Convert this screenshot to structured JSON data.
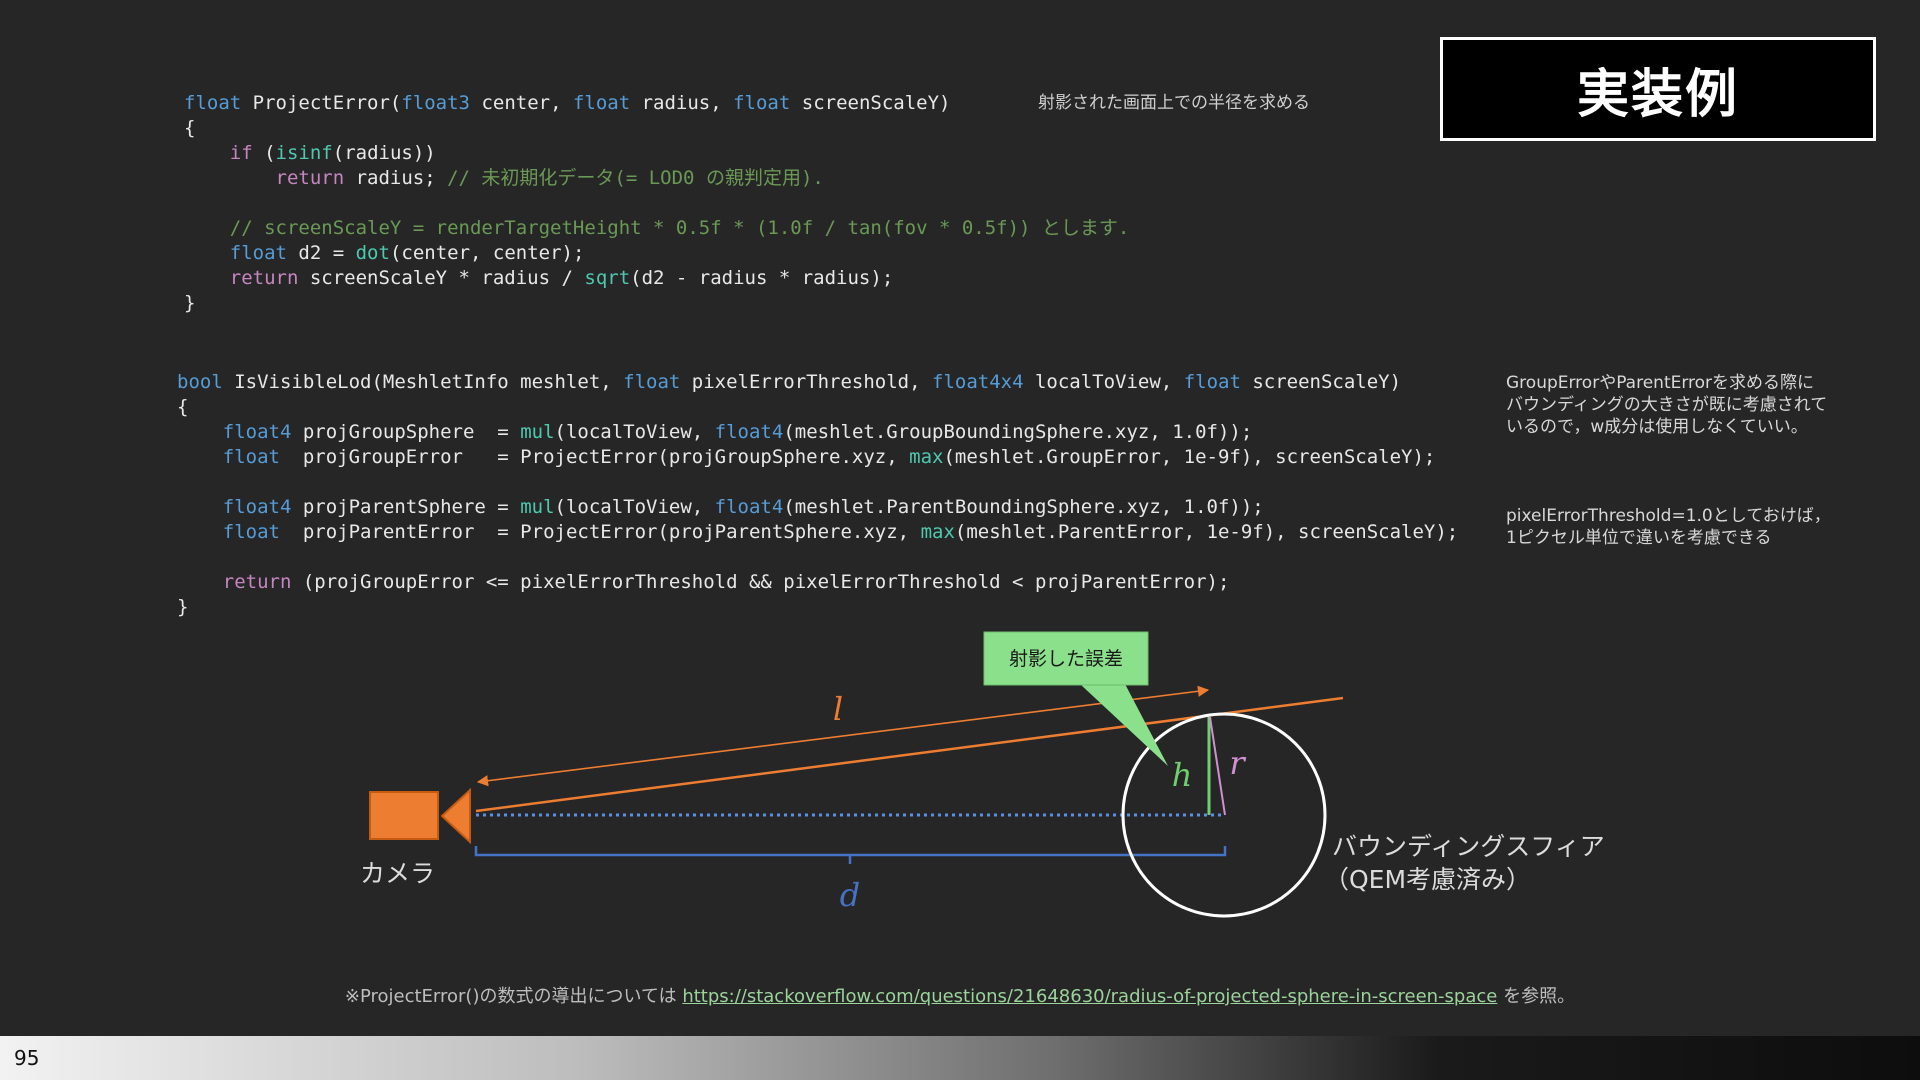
{
  "title": "実装例",
  "page_number": "95",
  "code1": {
    "lines": [
      [
        {
          "c": "kw",
          "t": "float"
        },
        {
          "c": "",
          "t": " ProjectError("
        },
        {
          "c": "kw",
          "t": "float3"
        },
        {
          "c": "",
          "t": " center, "
        },
        {
          "c": "kw",
          "t": "float"
        },
        {
          "c": "",
          "t": " radius, "
        },
        {
          "c": "kw",
          "t": "float"
        },
        {
          "c": "",
          "t": " screenScaleY)"
        }
      ],
      [
        {
          "c": "",
          "t": "{"
        }
      ],
      [
        {
          "c": "",
          "t": "    "
        },
        {
          "c": "ctl",
          "t": "if"
        },
        {
          "c": "",
          "t": " ("
        },
        {
          "c": "fn",
          "t": "isinf"
        },
        {
          "c": "",
          "t": "(radius))"
        }
      ],
      [
        {
          "c": "",
          "t": "        "
        },
        {
          "c": "ctl",
          "t": "return"
        },
        {
          "c": "",
          "t": " radius; "
        },
        {
          "c": "cm",
          "t": "// 未初期化データ(= LOD0 の親判定用)."
        }
      ],
      [
        {
          "c": "",
          "t": ""
        }
      ],
      [
        {
          "c": "",
          "t": "    "
        },
        {
          "c": "cm",
          "t": "// screenScaleY = renderTargetHeight * 0.5f * (1.0f / tan(fov * 0.5f)) とします."
        }
      ],
      [
        {
          "c": "",
          "t": "    "
        },
        {
          "c": "kw",
          "t": "float"
        },
        {
          "c": "",
          "t": " d2 = "
        },
        {
          "c": "fn",
          "t": "dot"
        },
        {
          "c": "",
          "t": "(center, center);"
        }
      ],
      [
        {
          "c": "",
          "t": "    "
        },
        {
          "c": "ctl",
          "t": "return"
        },
        {
          "c": "",
          "t": " screenScaleY * radius / "
        },
        {
          "c": "fn",
          "t": "sqrt"
        },
        {
          "c": "",
          "t": "(d2 - radius * radius);"
        }
      ],
      [
        {
          "c": "",
          "t": "}"
        }
      ]
    ]
  },
  "code2": {
    "lines": [
      [
        {
          "c": "kw",
          "t": "bool"
        },
        {
          "c": "",
          "t": " IsVisibleLod(MeshletInfo meshlet, "
        },
        {
          "c": "kw",
          "t": "float"
        },
        {
          "c": "",
          "t": " pixelErrorThreshold, "
        },
        {
          "c": "kw",
          "t": "float4x4"
        },
        {
          "c": "",
          "t": " localToView, "
        },
        {
          "c": "kw",
          "t": "float"
        },
        {
          "c": "",
          "t": " screenScaleY)"
        }
      ],
      [
        {
          "c": "",
          "t": "{"
        }
      ],
      [
        {
          "c": "",
          "t": "    "
        },
        {
          "c": "kw",
          "t": "float4"
        },
        {
          "c": "",
          "t": " projGroupSphere  = "
        },
        {
          "c": "fn",
          "t": "mul"
        },
        {
          "c": "",
          "t": "(localToView, "
        },
        {
          "c": "kw",
          "t": "float4"
        },
        {
          "c": "",
          "t": "(meshlet.GroupBoundingSphere.xyz, 1.0f));"
        }
      ],
      [
        {
          "c": "",
          "t": "    "
        },
        {
          "c": "kw",
          "t": "float"
        },
        {
          "c": "",
          "t": "  projGroupError   = ProjectError(projGroupSphere.xyz, "
        },
        {
          "c": "fn",
          "t": "max"
        },
        {
          "c": "",
          "t": "(meshlet.GroupError, 1e-9f), screenScaleY);"
        }
      ],
      [
        {
          "c": "",
          "t": ""
        }
      ],
      [
        {
          "c": "",
          "t": "    "
        },
        {
          "c": "kw",
          "t": "float4"
        },
        {
          "c": "",
          "t": " projParentSphere = "
        },
        {
          "c": "fn",
          "t": "mul"
        },
        {
          "c": "",
          "t": "(localToView, "
        },
        {
          "c": "kw",
          "t": "float4"
        },
        {
          "c": "",
          "t": "(meshlet.ParentBoundingSphere.xyz, 1.0f));"
        }
      ],
      [
        {
          "c": "",
          "t": "    "
        },
        {
          "c": "kw",
          "t": "float"
        },
        {
          "c": "",
          "t": "  projParentError  = ProjectError(projParentSphere.xyz, "
        },
        {
          "c": "fn",
          "t": "max"
        },
        {
          "c": "",
          "t": "(meshlet.ParentError, 1e-9f), screenScaleY);"
        }
      ],
      [
        {
          "c": "",
          "t": ""
        }
      ],
      [
        {
          "c": "",
          "t": "    "
        },
        {
          "c": "ctl",
          "t": "return"
        },
        {
          "c": "",
          "t": " (projGroupError <= pixelErrorThreshold && pixelErrorThreshold < projParentError);"
        }
      ],
      [
        {
          "c": "",
          "t": "}"
        }
      ]
    ]
  },
  "notes": {
    "projected_radius": "射影された画面上での半径を求める",
    "group_error_1": "GroupErrorやParentErrorを求める際に",
    "group_error_2": "バウンディングの大きさが既に考慮されて",
    "group_error_3": "いるので，w成分は使用しなくていい。",
    "threshold_1": "pixelErrorThreshold=1.0としておけば，",
    "threshold_2": "1ピクセル単位で違いを考慮できる"
  },
  "diagram": {
    "callout": "射影した誤差",
    "camera_label": "カメラ",
    "sphere_label_1": "バウンディングスフィア",
    "sphere_label_2": "（QEM考慮済み）",
    "label_l": "l",
    "label_d": "d",
    "label_h": "h",
    "label_r": "r",
    "colors": {
      "orange": "#ed7d31",
      "blue": "#4472c4",
      "green": "#70d070",
      "pink": "#d090d0",
      "white": "#ffffff"
    }
  },
  "reference": {
    "prefix": "※ProjectError()の数式の導出については",
    "link": "https://stackoverflow.com/questions/21648630/radius-of-projected-sphere-in-screen-space",
    "suffix": "を参照。"
  }
}
